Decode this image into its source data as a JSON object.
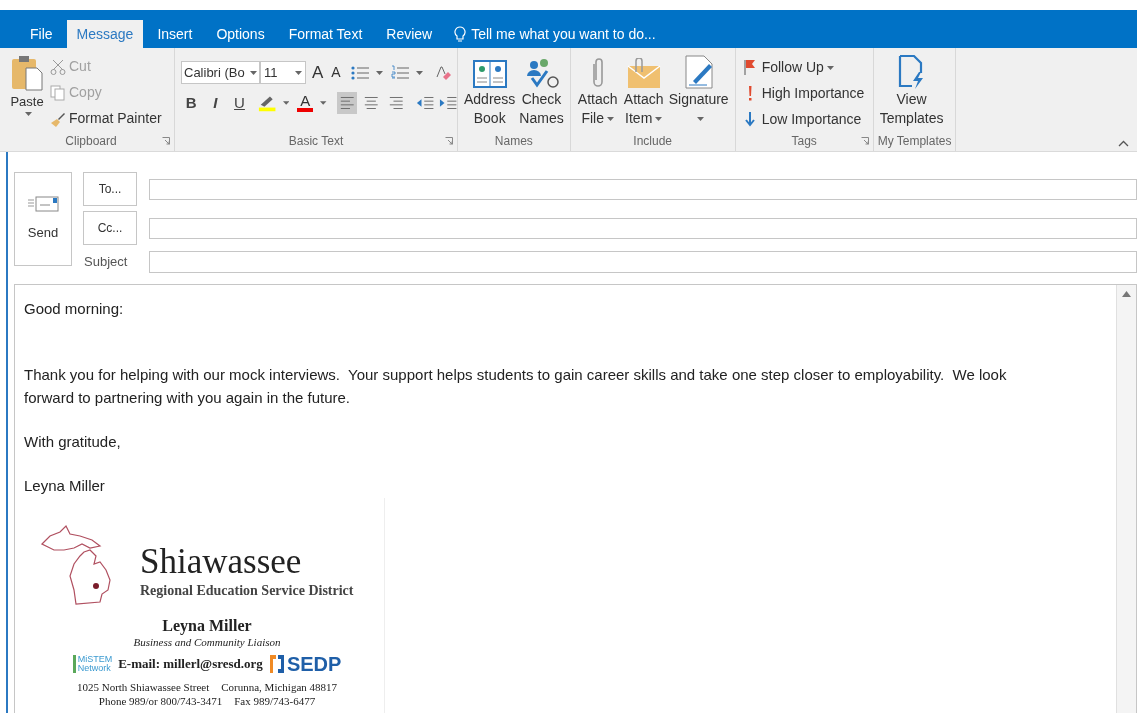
{
  "tabs": [
    {
      "label": "File",
      "selected": false
    },
    {
      "label": "Message",
      "selected": true
    },
    {
      "label": "Insert",
      "selected": false
    },
    {
      "label": "Options",
      "selected": false
    },
    {
      "label": "Format Text",
      "selected": false
    },
    {
      "label": "Review",
      "selected": false
    }
  ],
  "tell_me": "Tell me what you want to do...",
  "groups": [
    {
      "kind": "clipboard",
      "label": "Clipboard",
      "launcher": true,
      "paste": "Paste",
      "items": [
        {
          "label": "Cut",
          "disabled": true
        },
        {
          "label": "Copy",
          "disabled": true
        },
        {
          "label": "Format Painter",
          "disabled": false
        }
      ]
    },
    {
      "kind": "basic_text",
      "label": "Basic Text",
      "launcher": true,
      "font": "Calibri (Bo",
      "size": "11",
      "grow": "A",
      "shrink": "A",
      "styles": [
        "B",
        "I",
        "U"
      ],
      "font_color": "A",
      "alignments": [
        {
          "selected": true
        },
        {
          "selected": false
        },
        {
          "selected": false
        }
      ]
    },
    {
      "kind": "large_buttons",
      "label": "Names",
      "launcher": false,
      "buttons": [
        {
          "kind": "address_book",
          "label": "Address Book",
          "dropdown": false
        },
        {
          "kind": "check_names",
          "label": "Check Names",
          "dropdown": false
        }
      ]
    },
    {
      "kind": "large_buttons",
      "label": "Include",
      "launcher": false,
      "buttons": [
        {
          "kind": "attach_file",
          "label": "Attach File",
          "dropdown": true
        },
        {
          "kind": "attach_item",
          "label": "Attach Item",
          "dropdown": true
        },
        {
          "kind": "signature",
          "label": "Signature",
          "dropdown": true
        }
      ]
    },
    {
      "kind": "tags",
      "label": "Tags",
      "launcher": true,
      "items": [
        {
          "kind": "flag",
          "label": "Follow Up",
          "dropdown": true
        },
        {
          "kind": "high",
          "label": "High Importance",
          "dropdown": false
        },
        {
          "kind": "low",
          "label": "Low Importance",
          "dropdown": false
        }
      ]
    },
    {
      "kind": "large_buttons",
      "label": "My Templates",
      "launcher": false,
      "buttons": [
        {
          "kind": "templates",
          "label": "View Templates",
          "dropdown": false
        }
      ]
    }
  ],
  "compose": {
    "send": "Send",
    "to": "To...",
    "cc": "Cc...",
    "subject": "Subject"
  },
  "body": {
    "paragraphs": [
      "Good morning:",
      "Thank you for helping with our mock interviews.  Your support helps students to gain career skills and take one step closer to employability.  We look forward to partnering with you again in the future.",
      "With gratitude,",
      "Leyna Miller"
    ],
    "signature_card": {
      "org": "Shiawassee",
      "org_sub": "Regional Education Service District",
      "name": "Leyna Miller",
      "title": "Business and Community Liaison",
      "logo_left": [
        "MiSTEM",
        "Network"
      ],
      "email": "E-mail: millerl@sresd.org",
      "logo_right": "SEDP",
      "address": [
        "1025 North Shiawassee Street",
        "Corunna, Michigan 48817"
      ],
      "phone": [
        "Phone 989/or 800/743-3471",
        "Fax 989/743-6477"
      ]
    }
  }
}
